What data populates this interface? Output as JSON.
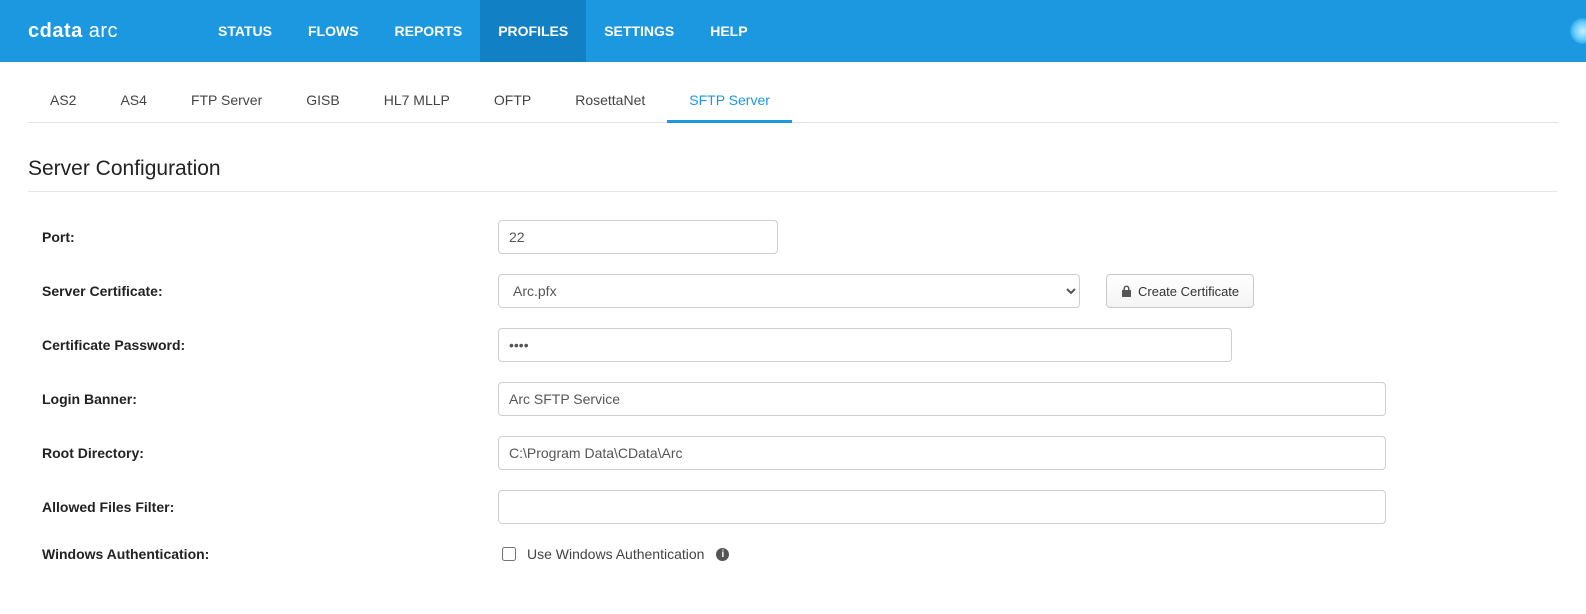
{
  "brand": {
    "heavy": "cdata",
    "light": "arc"
  },
  "nav": {
    "items": [
      "STATUS",
      "FLOWS",
      "REPORTS",
      "PROFILES",
      "SETTINGS",
      "HELP"
    ],
    "active": "PROFILES"
  },
  "subtabs": {
    "items": [
      "AS2",
      "AS4",
      "FTP Server",
      "GISB",
      "HL7 MLLP",
      "OFTP",
      "RosettaNet",
      "SFTP Server"
    ],
    "active": "SFTP Server"
  },
  "section": {
    "title": "Server Configuration"
  },
  "form": {
    "port": {
      "label": "Port:",
      "value": "22"
    },
    "server_cert": {
      "label": "Server Certificate:",
      "value": "Arc.pfx",
      "create_btn": "Create Certificate"
    },
    "cert_password": {
      "label": "Certificate Password:",
      "value": "••••"
    },
    "login_banner": {
      "label": "Login Banner:",
      "value": "Arc SFTP Service"
    },
    "root_dir": {
      "label": "Root Directory:",
      "value": "C:\\Program Data\\CData\\Arc"
    },
    "allowed_filter": {
      "label": "Allowed Files Filter:",
      "value": ""
    },
    "win_auth": {
      "label": "Windows Authentication:",
      "checkbox_label": "Use Windows Authentication",
      "checked": false
    }
  }
}
